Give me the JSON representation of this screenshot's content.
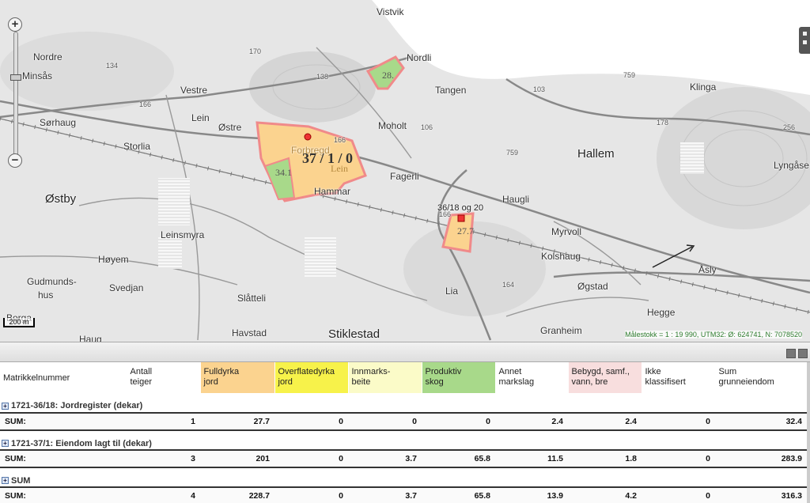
{
  "colors": {
    "fulldyrka": "#fbd38f",
    "overflatedyrka": "#f7f24a",
    "innmarksbeite": "#fbfbc8",
    "produktiv_skog": "#a8d98a",
    "annet_markslag": "#ffffff",
    "bebygd": "#f8dede",
    "parcel_border": "#f08a8a"
  },
  "map": {
    "places": [
      {
        "name": "Vistvik"
      },
      {
        "name": "Nordre"
      },
      {
        "name": "Minsås"
      },
      {
        "name": "Nordli"
      },
      {
        "name": "Tangen"
      },
      {
        "name": "Vestre"
      },
      {
        "name": "Klinga"
      },
      {
        "name": "Sørhaug"
      },
      {
        "name": "Lein"
      },
      {
        "name": "Østre"
      },
      {
        "name": "Moholt"
      },
      {
        "name": "Storlia"
      },
      {
        "name": "Forbregd"
      },
      {
        "name": "Hallem"
      },
      {
        "name": "Fagerli"
      },
      {
        "name": "Lyngåse"
      },
      {
        "name": "Hammar"
      },
      {
        "name": "Østby"
      },
      {
        "name": "Haugli"
      },
      {
        "name": "Myrvoll"
      },
      {
        "name": "Leinsmyra"
      },
      {
        "name": "Kolshaug"
      },
      {
        "name": "Høyem"
      },
      {
        "name": "Åsly"
      },
      {
        "name": "Gudmunds-"
      },
      {
        "name": "hus"
      },
      {
        "name": "Svedjan"
      },
      {
        "name": "Lia"
      },
      {
        "name": "Øgstad"
      },
      {
        "name": "Slåtteli"
      },
      {
        "name": "Hegge"
      },
      {
        "name": "Borga"
      },
      {
        "name": "Havstad"
      },
      {
        "name": "Stiklestad"
      },
      {
        "name": "Granheim"
      },
      {
        "name": "Haug"
      }
    ],
    "road_numbers": [
      "170",
      "166",
      "134",
      "138",
      "759",
      "103",
      "178",
      "256",
      "106",
      "166",
      "759",
      "166",
      "164"
    ],
    "parcels": {
      "main_label": "37 / 1 / 0",
      "main_sublabel": "Lein",
      "forest_value": "34.1",
      "north_value": "28.",
      "small_value": "27.7",
      "small_label": "36/18 og 20"
    },
    "scalebar_label": "200 m",
    "scale_text": "Målestokk = 1 : 19 990, UTM32: Ø: 624741, N: 7078520"
  },
  "table": {
    "headers": [
      [
        "Matrikkelnummer"
      ],
      [
        "Antall",
        "teiger"
      ],
      [
        "Fulldyrka",
        "jord"
      ],
      [
        "Overflatedyrka",
        "jord"
      ],
      [
        "Innmarks-",
        "beite"
      ],
      [
        "Produktiv",
        "skog"
      ],
      [
        "Annet",
        "markslag"
      ],
      [
        "Bebygd, samf.,",
        "vann, bre"
      ],
      [
        "Ikke",
        "klassifisert"
      ],
      [
        "Sum",
        "grunneiendom"
      ]
    ],
    "groups": [
      {
        "title": "1721-36/18: Jordregister (dekar)",
        "sum": [
          "SUM:",
          "1",
          "27.7",
          "0",
          "0",
          "0",
          "2.4",
          "2.4",
          "0",
          "32.4"
        ]
      },
      {
        "title": "1721-37/1: Eiendom lagt til (dekar)",
        "sum": [
          "SUM:",
          "3",
          "201",
          "0",
          "3.7",
          "65.8",
          "11.5",
          "1.8",
          "0",
          "283.9"
        ]
      },
      {
        "title": "SUM",
        "sum": [
          "SUM:",
          "4",
          "228.7",
          "0",
          "3.7",
          "65.8",
          "13.9",
          "4.2",
          "0",
          "316.3"
        ]
      }
    ]
  }
}
